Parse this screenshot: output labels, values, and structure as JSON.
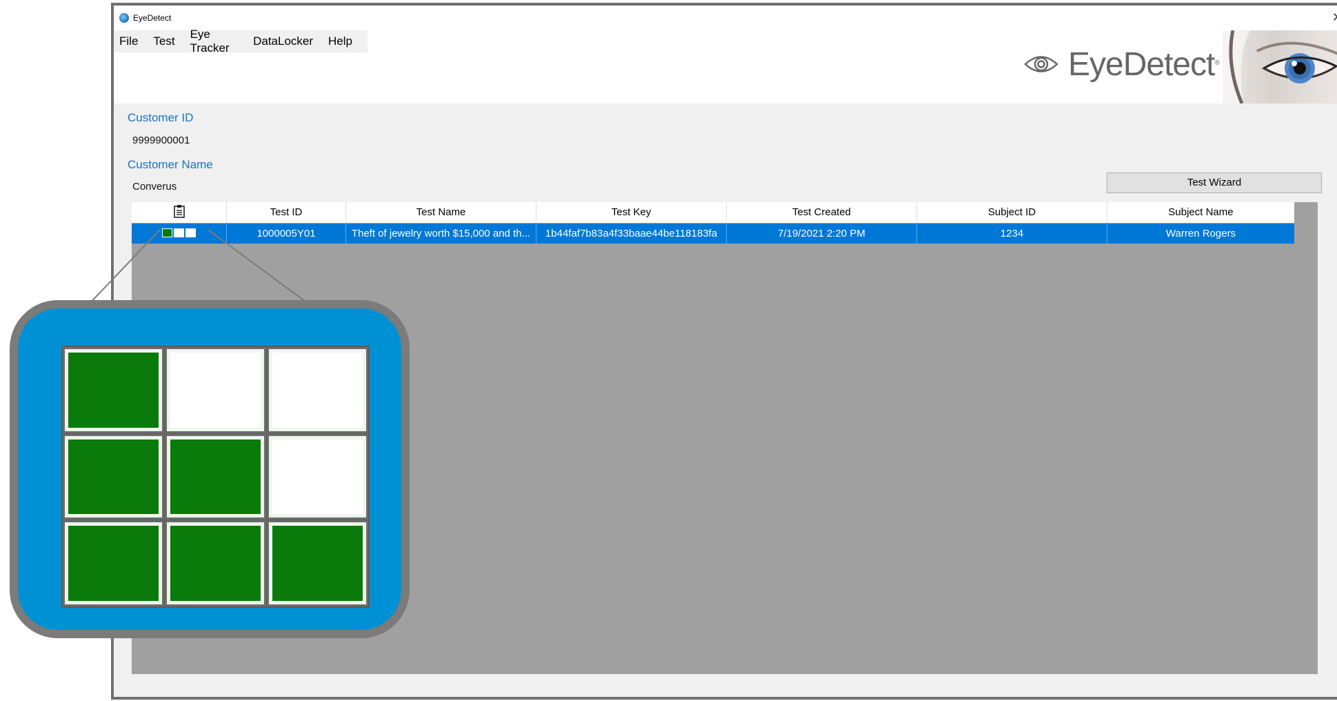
{
  "window": {
    "title": "EyeDetect",
    "close_glyph": "✕"
  },
  "menu": {
    "items": [
      "File",
      "Test",
      "Eye Tracker",
      "DataLocker",
      "Help"
    ]
  },
  "logo": {
    "text": "EyeDetect",
    "reg": "®"
  },
  "customer": {
    "id_label": "Customer ID",
    "id_value": "9999900001",
    "name_label": "Customer Name",
    "name_value": "Converus"
  },
  "buttons": {
    "test_wizard": "Test Wizard"
  },
  "table": {
    "status_header_icon": "clipboard-icon",
    "columns": [
      "Test ID",
      "Test Name",
      "Test Key",
      "Test Created",
      "Subject ID",
      "Subject Name"
    ],
    "rows": [
      {
        "status": [
          true,
          false,
          false
        ],
        "test_id": "1000005Y01",
        "test_name": "Theft of jewelry worth $15,000 and th...",
        "test_key": "1b44faf7b83a4f33baae44be118183fa",
        "test_created": "7/19/2021 2:20 PM",
        "subject_id": "1234",
        "subject_name": "Warren Rogers"
      }
    ]
  },
  "status_legend": {
    "rows": [
      [
        true,
        false,
        false
      ],
      [
        true,
        true,
        false
      ],
      [
        true,
        true,
        true
      ]
    ]
  },
  "colors": {
    "accent": "#0078d7",
    "label_blue": "#1a74c0",
    "status_green": "#0a7a0a",
    "status_empty": "#ffffff",
    "callout_bg": "#0091d4"
  }
}
